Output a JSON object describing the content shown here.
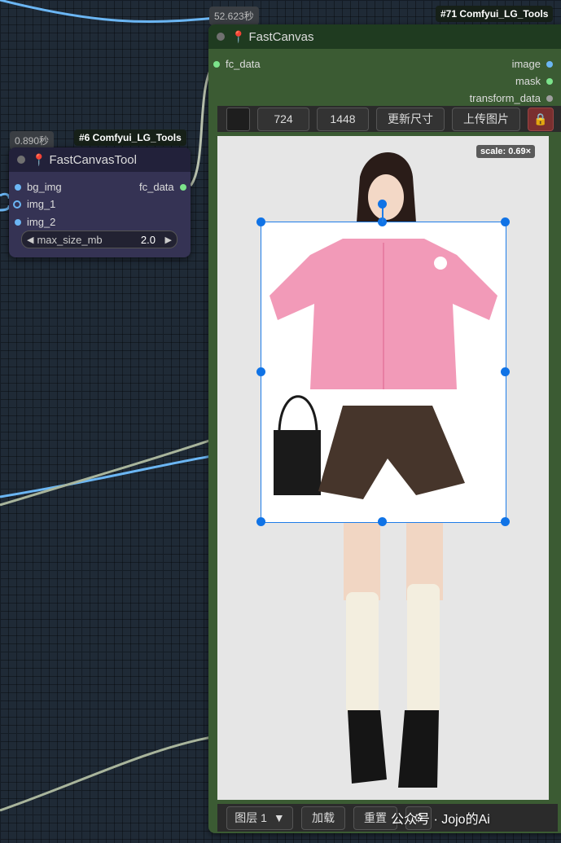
{
  "tags": {
    "canvas_time": "52.623秒",
    "canvas_id": "#71 Comfyui_LG_Tools",
    "tool_time": "0.890秒",
    "tool_id": "#6 Comfyui_LG_Tools"
  },
  "tool_node": {
    "title": "FastCanvasTool",
    "inputs": [
      "bg_img",
      "img_1",
      "img_2"
    ],
    "output": "fc_data",
    "widget": {
      "name": "max_size_mb",
      "value": "2.0"
    }
  },
  "canvas_node": {
    "title": "FastCanvas",
    "input": "fc_data",
    "outputs": [
      "image",
      "mask",
      "transform_data"
    ],
    "toolbar": {
      "width": "724",
      "height": "1448",
      "update_size": "更新尺寸",
      "upload_image": "上传图片",
      "lock_icon": "lock-icon"
    },
    "scale_label": "scale: 0.69×",
    "bottom": {
      "layer_select": "图层 1",
      "load_btn": "加载",
      "reset_btn": "重置"
    }
  },
  "watermark": "公众号 · Jojo的Ai",
  "colors": {
    "canvas_node_body": "#3b5b33",
    "tool_node_body": "#353354",
    "selection": "#1e7ce8",
    "wire_blue": "#6bb6f4",
    "wire_gray": "#a9b59c"
  }
}
